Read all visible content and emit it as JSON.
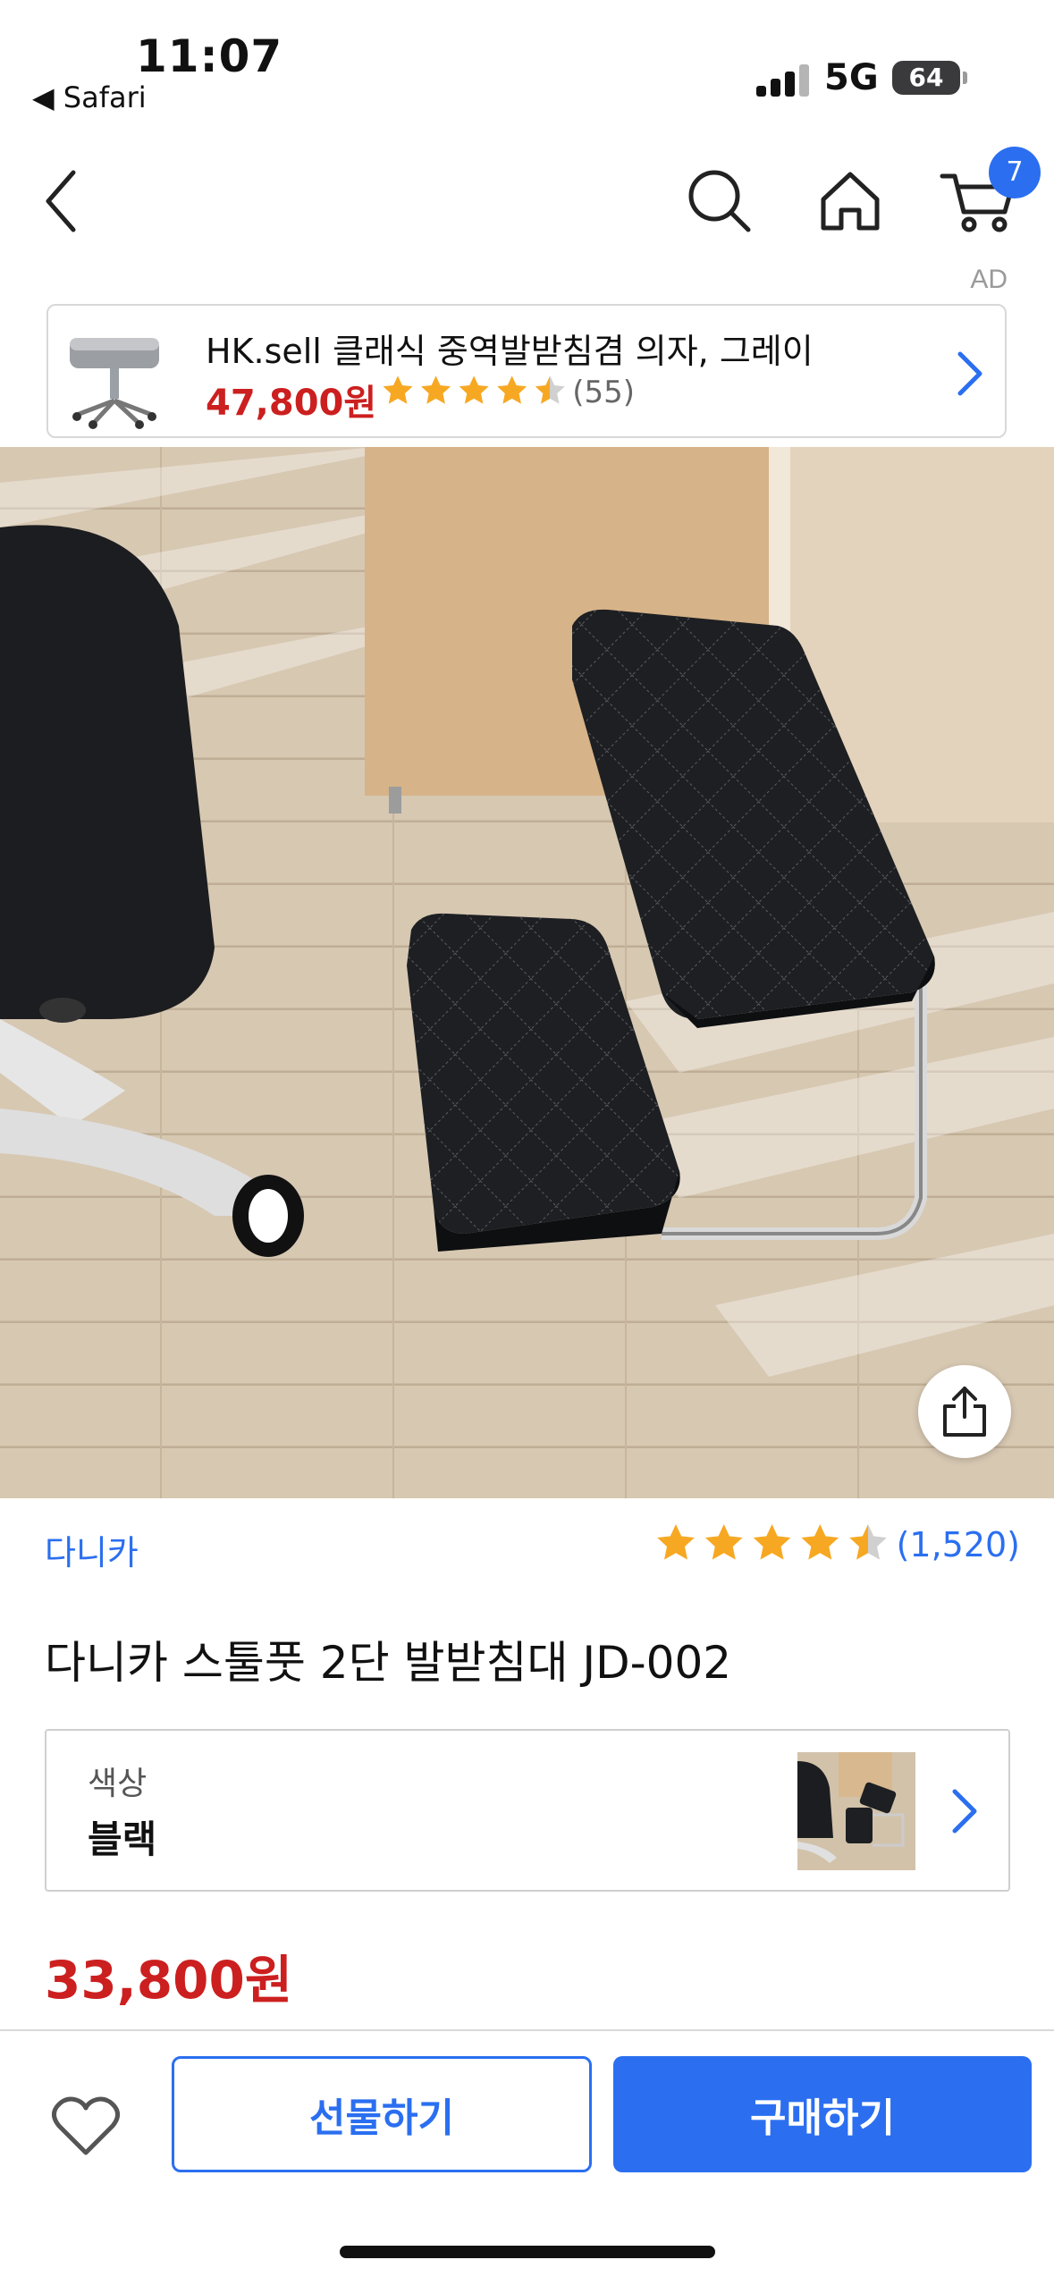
{
  "status_bar": {
    "time": "11:07",
    "back_app": "◀ Safari",
    "network": "5G",
    "battery": "64"
  },
  "nav": {
    "cart_count": "7",
    "icons": [
      "back-chevron-icon",
      "search-icon",
      "home-icon",
      "cart-icon"
    ]
  },
  "ad": {
    "label": "AD",
    "title": "HK.sell 클래식 중역발받침겸 의자, 그레이",
    "price": "47,800원",
    "rating": 4.5,
    "review_count": "(55)"
  },
  "product": {
    "seller": "다니카",
    "rating": 4.5,
    "review_count": "(1,520)",
    "title": "다니카 스툴풋 2단 발받침대 JD-002",
    "option_label": "색상",
    "option_value": "블랙",
    "price": "33,800원"
  },
  "actions": {
    "gift_label": "선물하기",
    "buy_label": "구매하기"
  },
  "colors": {
    "accent": "#2b6ff0",
    "price": "#cc1f1f",
    "star": "#f7a823"
  }
}
